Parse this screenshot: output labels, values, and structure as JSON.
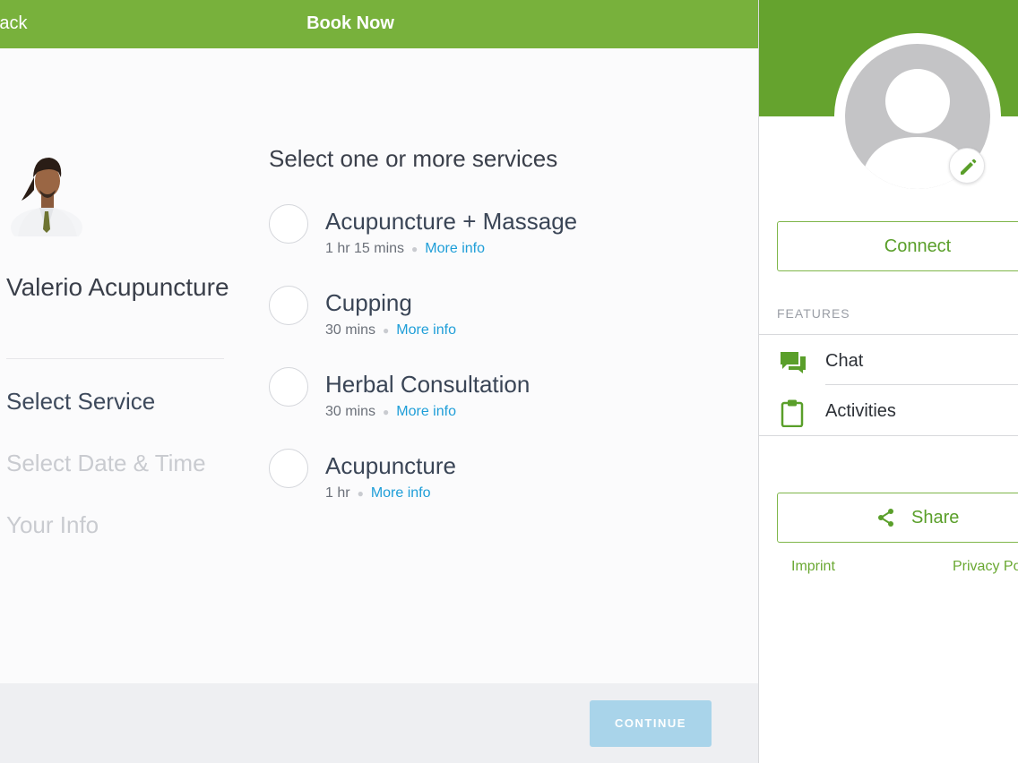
{
  "topbar": {
    "back_label": "Back",
    "title": "Book Now"
  },
  "business": {
    "name": "Valerio Acupuncture"
  },
  "steps": [
    {
      "label": "Select Service",
      "state": "active"
    },
    {
      "label": "Select Date & Time",
      "state": "inactive"
    },
    {
      "label": "Your Info",
      "state": "inactive"
    }
  ],
  "services": {
    "heading": "Select one or more services",
    "items": [
      {
        "name": "Acupuncture + Massage",
        "duration": "1 hr 15 mins",
        "more": "More info",
        "selected": false
      },
      {
        "name": "Cupping",
        "duration": "30 mins",
        "more": "More info",
        "selected": false
      },
      {
        "name": "Herbal Consultation",
        "duration": "30 mins",
        "more": "More info",
        "selected": false
      },
      {
        "name": "Acupuncture",
        "duration": "1 hr",
        "more": "More info",
        "selected": false
      }
    ]
  },
  "footer": {
    "continue_label": "CONTINUE",
    "continue_enabled": false
  },
  "profile": {
    "connect_label": "Connect",
    "features_label": "FEATURES",
    "features": [
      {
        "label": "Chat",
        "icon": "chat-icon"
      },
      {
        "label": "Activities",
        "icon": "clipboard-icon"
      }
    ],
    "share_label": "Share",
    "imprint_label": "Imprint",
    "privacy_label": "Privacy Policy"
  },
  "colors": {
    "brand_green": "#78b13c",
    "link_blue": "#1e9ed8",
    "continue_disabled": "#a9d4ea"
  }
}
